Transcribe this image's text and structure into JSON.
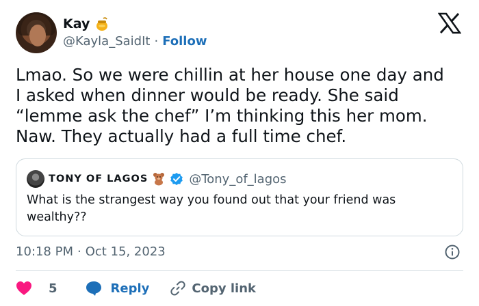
{
  "tweet": {
    "author_name": "Kay",
    "author_handle": "@Kayla_SaidIt",
    "separator": "·",
    "follow_label": "Follow",
    "text": "Lmao. So we were chillin at her house one day and\nI asked when dinner would be ready. She said\n“lemme ask the chef” I’m thinking this her mom.\nNaw. They actually had a full time chef.",
    "timestamp_time": "10:18 PM",
    "timestamp_sep": "·",
    "timestamp_date": "Oct 15, 2023"
  },
  "quote": {
    "author_name": "TONY OF LAGOS",
    "author_handle": "@Tony_of_lagos",
    "text": "What is the strangest way you found out that your friend was wealthy??"
  },
  "actions": {
    "like_count": "5",
    "reply_label": "Reply",
    "copy_link_label": "Copy link"
  },
  "colors": {
    "link_blue": "#1d6fb8",
    "verified_blue": "#1d9bf0",
    "heart_red": "#f91880",
    "muted_gray": "#536471",
    "border": "#cfd9de"
  },
  "icons": [
    "honey-pot-icon",
    "x-logo-icon",
    "teddy-bear-icon",
    "verified-badge-icon",
    "info-icon",
    "heart-icon",
    "reply-bubble-icon",
    "link-icon"
  ]
}
